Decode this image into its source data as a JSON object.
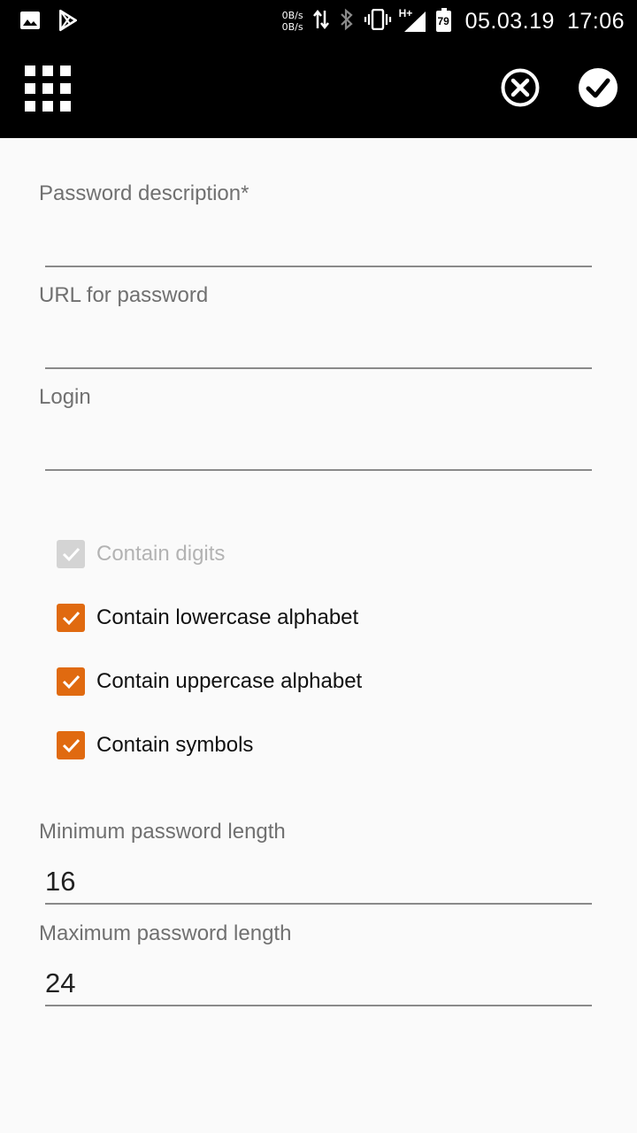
{
  "status_bar": {
    "left_icons": [
      "image-icon",
      "play-store-icon"
    ],
    "net_up": "0B/s",
    "net_down": "0B/s",
    "right_icons": [
      "data-transfer-icon",
      "bluetooth-icon",
      "vibrate-icon",
      "signal-h-plus-icon"
    ],
    "network_type": "H+",
    "battery": "79",
    "date": "05.03.19",
    "time": "17:06"
  },
  "toolbar": {
    "menu_icon": "grid-icon",
    "cancel_icon": "cancel-circle-icon",
    "confirm_icon": "confirm-check-icon"
  },
  "form": {
    "description_label": "Password description*",
    "description_value": "",
    "url_label": "URL for password",
    "url_value": "",
    "login_label": "Login",
    "login_value": "",
    "checkboxes": [
      {
        "label": "Contain digits",
        "checked": true,
        "enabled": false
      },
      {
        "label": "Contain lowercase alphabet",
        "checked": true,
        "enabled": true
      },
      {
        "label": "Contain uppercase alphabet",
        "checked": true,
        "enabled": true
      },
      {
        "label": "Contain symbols",
        "checked": true,
        "enabled": true
      }
    ],
    "min_length_label": "Minimum password length",
    "min_length_value": "16",
    "max_length_label": "Maximum password length",
    "max_length_value": "24"
  },
  "colors": {
    "accent": "#e06a10",
    "bar_background": "#000000",
    "page_background": "#fafafa"
  }
}
